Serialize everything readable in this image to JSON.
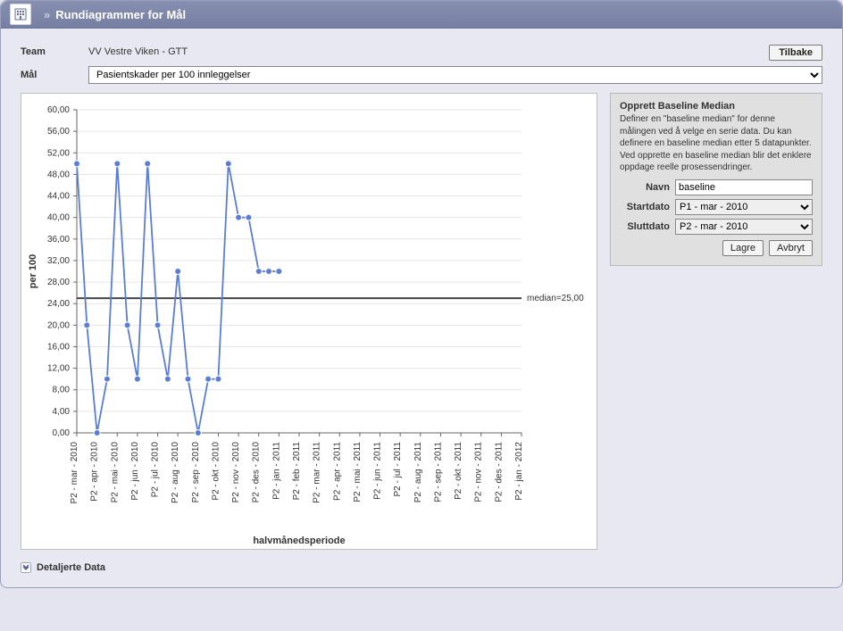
{
  "window": {
    "title": "Rundiagrammer for Mål"
  },
  "actions": {
    "back": "Tilbake"
  },
  "form": {
    "team_label": "Team",
    "team_value": "VV Vestre Viken - GTT",
    "goal_label": "Mål",
    "goal_selected": "Pasientskader per 100 innleggelser"
  },
  "baseline": {
    "title": "Opprett Baseline Median",
    "desc": "Definer en \"baseline median\" for denne målingen ved å velge en serie data. Du kan definere en baseline median etter 5 datapunkter. Ved opprette en baseline median blir det enklere oppdage reelle prosessendringer.",
    "name_label": "Navn",
    "name_value": "baseline",
    "start_label": "Startdato",
    "start_value": "P1 - mar - 2010",
    "end_label": "Sluttdato",
    "end_value": "P2 - mar - 2010",
    "save_label": "Lagre",
    "cancel_label": "Avbryt"
  },
  "detail": {
    "label": "Detaljerte Data"
  },
  "chart_data": {
    "type": "line",
    "title": "",
    "xlabel": "halvmånedsperiode",
    "ylabel": "per 100",
    "ylim": [
      0,
      60
    ],
    "yticks": [
      0,
      4,
      8,
      12,
      16,
      20,
      24,
      28,
      32,
      36,
      40,
      44,
      48,
      52,
      56,
      60
    ],
    "median": 25.0,
    "median_label": "median=25,00",
    "categories": [
      "P2 - mar - 2010",
      "P2 - apr - 2010",
      "P2 - mai - 2010",
      "P2 - jun - 2010",
      "P2 - jul - 2010",
      "P2 - aug - 2010",
      "P2 - sep - 2010",
      "P2 - okt - 2010",
      "P2 - nov - 2010",
      "P2 - des - 2010",
      "P2 - jan - 2011",
      "P2 - feb - 2011",
      "P2 - mar - 2011",
      "P2 - apr - 2011",
      "P2 - mai - 2011",
      "P2 - jun - 2011",
      "P2 - jul - 2011",
      "P2 - aug - 2011",
      "P2 - sep - 2011",
      "P2 - okt - 2011",
      "P2 - nov - 2011",
      "P2 - des - 2011",
      "P2 - jan - 2012"
    ],
    "series": [
      {
        "name": "Pasientskader per 100 innleggelser",
        "values": [
          50,
          20,
          0,
          10,
          50,
          20,
          10,
          50,
          20,
          10,
          30,
          10,
          0,
          10,
          10,
          50,
          40,
          40,
          30,
          30,
          30,
          null,
          null
        ],
        "index_step": 0.5
      }
    ]
  }
}
